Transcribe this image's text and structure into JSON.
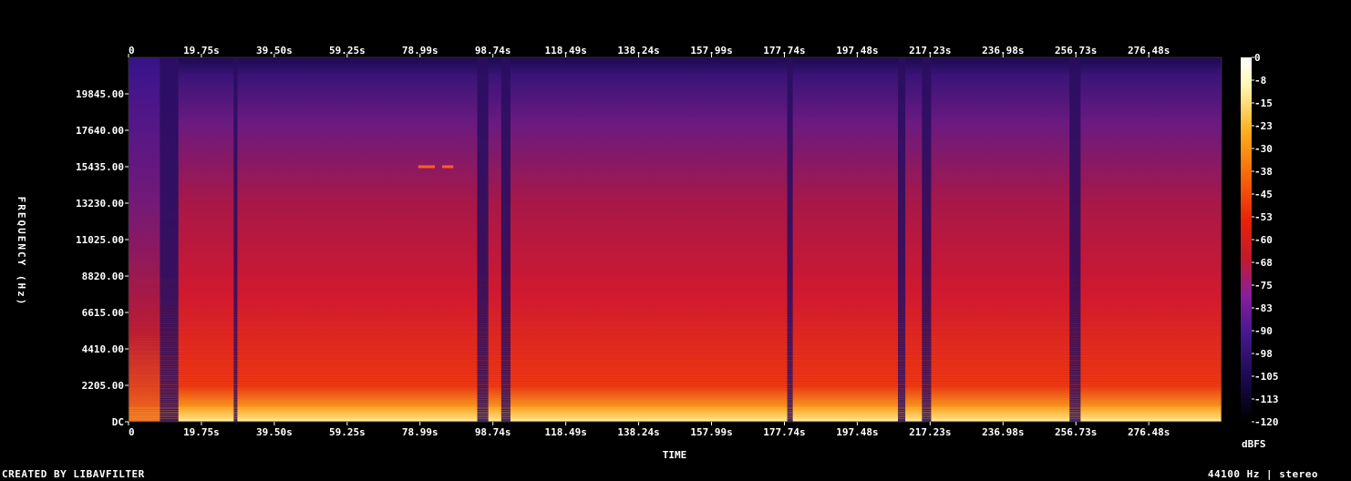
{
  "chart_data": {
    "type": "heatmap",
    "title": "",
    "xlabel": "TIME",
    "ylabel": "FREQUENCY (Hz)",
    "x_ticks": [
      "0",
      "19.75s",
      "39.50s",
      "59.25s",
      "78.99s",
      "98.74s",
      "118.49s",
      "138.24s",
      "157.99s",
      "177.74s",
      "197.48s",
      "217.23s",
      "236.98s",
      "256.73s",
      "276.48s"
    ],
    "x_tick_values": [
      0,
      19.75,
      39.5,
      59.25,
      78.99,
      98.74,
      118.49,
      138.24,
      157.99,
      177.74,
      197.48,
      217.23,
      236.98,
      256.73,
      276.48
    ],
    "xlim": [
      0,
      296.2
    ],
    "y_ticks": [
      "DC",
      "2205.00",
      "4410.00",
      "6615.00",
      "8820.00",
      "11025.00",
      "13230.00",
      "15435.00",
      "17640.00",
      "19845.00"
    ],
    "y_tick_values": [
      0,
      2205,
      4410,
      6615,
      8820,
      11025,
      13230,
      15435,
      17640,
      19845
    ],
    "ylim": [
      0,
      22050
    ],
    "colorbar": {
      "label": "dBFS",
      "ticks": [
        "0",
        "-8",
        "-15",
        "-23",
        "-30",
        "-38",
        "-45",
        "-53",
        "-60",
        "-68",
        "-75",
        "-83",
        "-90",
        "-98",
        "-105",
        "-113",
        "-120"
      ],
      "range": [
        -120,
        0
      ],
      "colors": [
        "#000000",
        "#1a0a50",
        "#4a1990",
        "#8a1e9c",
        "#c41a2a",
        "#e8200a",
        "#f86a0a",
        "#fcb020",
        "#fff7b0",
        "#ffffff"
      ]
    },
    "quiet_segments_s": [
      [
        8.5,
        13.5
      ],
      [
        28.5,
        29.5
      ],
      [
        94.5,
        97.5
      ],
      [
        101,
        103.5
      ],
      [
        178.5,
        180
      ],
      [
        208.5,
        210.5
      ],
      [
        215,
        217.5
      ],
      [
        255,
        258
      ]
    ],
    "tone_segments": [
      {
        "x": [
          78.5,
          83
        ],
        "freq": 15435
      },
      {
        "x": [
          85,
          88
        ],
        "freq": 15435
      }
    ],
    "intro_end_s": 13.5
  },
  "footer": {
    "left": "CREATED BY LIBAVFILTER",
    "right": "44100 Hz | stereo"
  }
}
